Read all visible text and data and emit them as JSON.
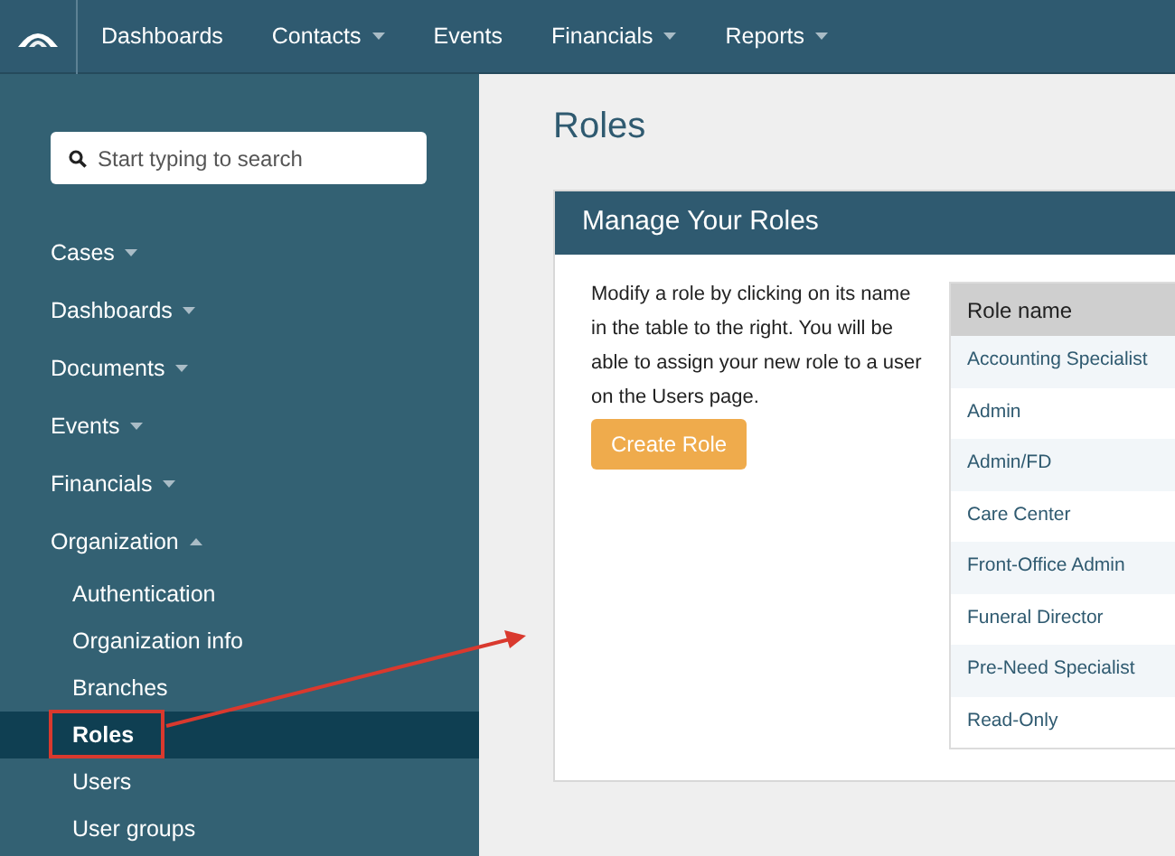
{
  "navbar": {
    "items": [
      {
        "label": "Dashboards",
        "dropdown": false
      },
      {
        "label": "Contacts",
        "dropdown": true
      },
      {
        "label": "Events",
        "dropdown": false
      },
      {
        "label": "Financials",
        "dropdown": true
      },
      {
        "label": "Reports",
        "dropdown": true
      }
    ]
  },
  "sidebar": {
    "search": {
      "placeholder": "Start typing to search"
    },
    "items": [
      {
        "label": "Cases",
        "expanded": false
      },
      {
        "label": "Dashboards",
        "expanded": false
      },
      {
        "label": "Documents",
        "expanded": false
      },
      {
        "label": "Events",
        "expanded": false
      },
      {
        "label": "Financials",
        "expanded": false
      },
      {
        "label": "Organization",
        "expanded": true,
        "children": [
          {
            "label": "Authentication",
            "selected": false
          },
          {
            "label": "Organization info",
            "selected": false
          },
          {
            "label": "Branches",
            "selected": false
          },
          {
            "label": "Roles",
            "selected": true
          },
          {
            "label": "Users",
            "selected": false
          },
          {
            "label": "User groups",
            "selected": false
          }
        ]
      }
    ]
  },
  "page": {
    "title": "Roles"
  },
  "card": {
    "title": "Manage Your Roles",
    "text": "Modify a role by clicking on its name in the table to the right. You will be able to assign your new role to a user on the Users page.",
    "button": "Create Role",
    "table": {
      "columns": [
        "Role name"
      ],
      "rows": [
        "Accounting Specialist",
        "Admin",
        "Admin/FD",
        "Care Center",
        "Front-Office Admin",
        "Funeral Director",
        "Pre-Need Specialist",
        "Read-Only"
      ]
    }
  }
}
